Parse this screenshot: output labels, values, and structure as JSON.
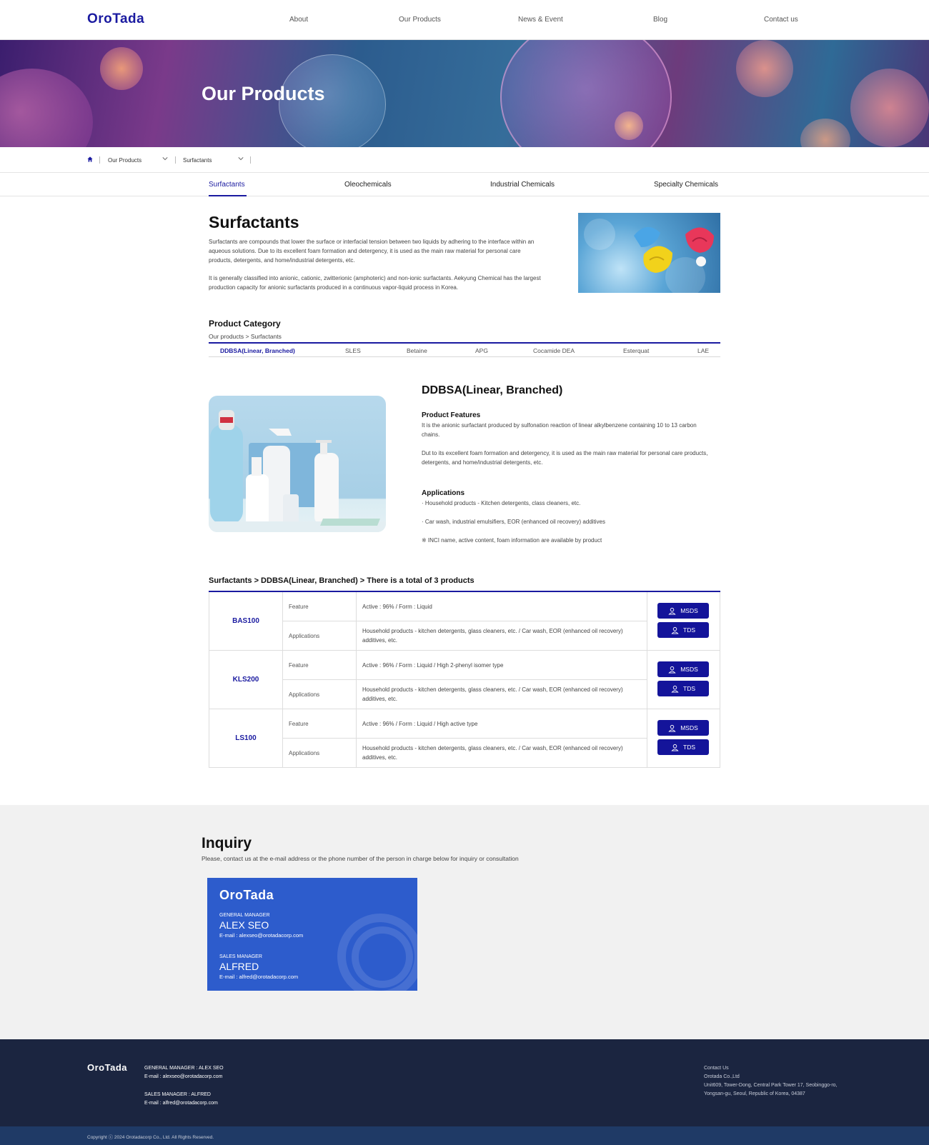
{
  "header": {
    "logo": "OroTada",
    "nav": [
      "About",
      "Our Products",
      "News & Event",
      "Blog",
      "Contact us"
    ]
  },
  "hero": {
    "title": "Our Products"
  },
  "breadcrumb": {
    "level1": "Our Products",
    "level2": "Surfactants"
  },
  "tabs": [
    "Surfactants",
    "Oleochemicals",
    "Industrial Chemicals",
    "Specialty Chemicals"
  ],
  "intro": {
    "title": "Surfactants",
    "p1": "Surfactants are compounds that lower the surface or interfacial tension between two liquids by adhering to the interface within an aqueous solutions. Due to its excellent foam formation and detergency, it is used as the main raw material for personal care products, detergents, and home/industrial detergents, etc.",
    "p2": "It is generally classified into anionic, cationic, zwitterionic (amphoteric) and non-ionic surfactants. Aekyung Chemical has the largest production capacity for anionic surfactants produced in a continuous vapor-liquid process in Korea."
  },
  "category": {
    "title": "Product Category",
    "path": "Our products > Surfactants",
    "items": [
      "DDBSA(Linear, Branched)",
      "SLES",
      "Betaine",
      "APG",
      "Cocamide DEA",
      "Esterquat",
      "LAE"
    ]
  },
  "product": {
    "name": "DDBSA(Linear, Branched)",
    "features_title": "Product Features",
    "features_p1": "It is the anionic surfactant produced by sulfonation reaction of linear alkylbenzene containing 10 to 13 carbon chains.",
    "features_p2": "Dut to its excellent foam formation and detergency, it is used as the main raw material for personal care products, detergents, and home/industrial detergents, etc.",
    "applications_title": "Applications",
    "app1": "· Household products - Kitchen detergents, class cleaners, etc.",
    "app2": "· Car wash, industrial emulsifiers, EOR (enhanced oil recovery) additives",
    "app3": "※ INCI name, active content, foam information are available by product"
  },
  "table": {
    "title": "Surfactants > DDBSA(Linear, Branched) > There is a total of 3 products",
    "feature_label": "Feature",
    "applications_label": "Applications",
    "msds_label": "MSDS",
    "tds_label": "TDS",
    "rows": [
      {
        "code": "BAS100",
        "feature": "Active : 96% / Form : Liquid",
        "applications": "Household products - kitchen detergents, glass cleaners, etc. / Car wash, EOR (enhanced oil recovery) additives, etc."
      },
      {
        "code": "KLS200",
        "feature": "Active : 96% / Form : Liquid / High 2-phenyl isomer type",
        "applications": "Household products - kitchen detergents, glass cleaners, etc. / Car wash, EOR (enhanced oil recovery) additives, etc."
      },
      {
        "code": "LS100",
        "feature": "Active : 96% / Form : Liquid / High active type",
        "applications": "Household products - kitchen detergents, glass cleaners, etc. / Car wash, EOR (enhanced oil recovery) additives, etc."
      }
    ]
  },
  "inquiry": {
    "title": "Inquiry",
    "desc": "Please, contact us at the e-mail address or the phone number of the person in charge below for inquiry or consultation",
    "card": {
      "logo": "OroTada",
      "role1": "GENERAL MANAGER",
      "name1": "ALEX SEO",
      "mail1": "E-mail : alexseo@orotadacorp.com",
      "role2": "SALES MANAGER",
      "name2": "ALFRED",
      "mail2": "E-mail : alfred@orotadacorp.com"
    }
  },
  "footer": {
    "logo": "OroTada",
    "gm": "GENERAL MANAGER : ALEX SEO",
    "gm_mail": "E-mail : alexseo@orotadacorp.com",
    "sm": "SALES MANAGER : ALFRED",
    "sm_mail": "E-mail : alfred@orotadacorp.com",
    "contact_title": "Contact Us",
    "company": "Orotada Co.,Ltd",
    "addr1": "Unit609, Tower-Dong, Central Park Tower 17, Seobinggo-ro,",
    "addr2": "Yongsan-gu, Seoul, Republic of Korea, 04387",
    "copyright": "Copyright ⓒ 2024 Orotadacorp Co., Ltd. All Rights Reserved."
  },
  "colors": {
    "brand": "#1a1aa0",
    "button": "#14149a",
    "card": "#2d5ccc",
    "footer": "#1b2540",
    "copyright_bar": "#1f3a66"
  }
}
